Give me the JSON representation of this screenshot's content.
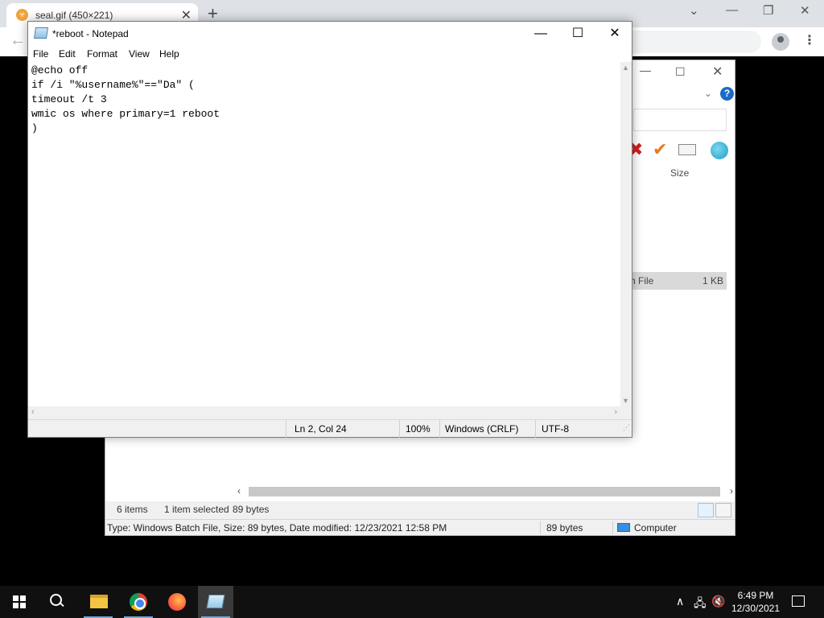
{
  "browser": {
    "tab_title": "seal.gif (450×221)",
    "tab_close": "✕",
    "new_tab": "+",
    "favicon_glyph": "☣",
    "window_min": "—",
    "window_restore": "❐",
    "window_close": "✕",
    "tab_search": "⌄",
    "back": "←",
    "menu": "⋮"
  },
  "explorer": {
    "min": "—",
    "max": "☐",
    "close": "✕",
    "ribbon_chevron": "⌄",
    "help": "?",
    "toolbar_delete": "✖",
    "toolbar_accept": "✔",
    "column_size": "Size",
    "selected_row": {
      "type": "h File",
      "size": "1 KB"
    },
    "scroll_left": "‹",
    "scroll_right": "›",
    "status": {
      "items": "6 items",
      "selected": "1 item selected",
      "selected_size": "89 bytes"
    },
    "details": {
      "info": "Type: Windows Batch File, Size: 89 bytes, Date modified: 12/23/2021 12:58 PM",
      "size": "89 bytes",
      "location": "Computer"
    }
  },
  "notepad": {
    "title": "*reboot - Notepad",
    "controls": {
      "minimize": "—",
      "maximize": "☐",
      "close": "✕"
    },
    "menu": [
      "File",
      "Edit",
      "Format",
      "View",
      "Help"
    ],
    "content": "@echo off\nif /i \"%username%\"==\"Da\" (\ntimeout /t 3\nwmic os where primary=1 reboot\n)",
    "scroll": {
      "up": "▲",
      "down": "▼",
      "left": "‹",
      "right": "›"
    },
    "status": {
      "position": "Ln 2, Col 24",
      "zoom": "100%",
      "line_ending": "Windows (CRLF)",
      "encoding": "UTF-8"
    }
  },
  "taskbar": {
    "tray_chevron": "∧",
    "tray_network": "🖧",
    "tray_volume": "🔇",
    "time": "6:49 PM",
    "date": "12/30/2021"
  }
}
